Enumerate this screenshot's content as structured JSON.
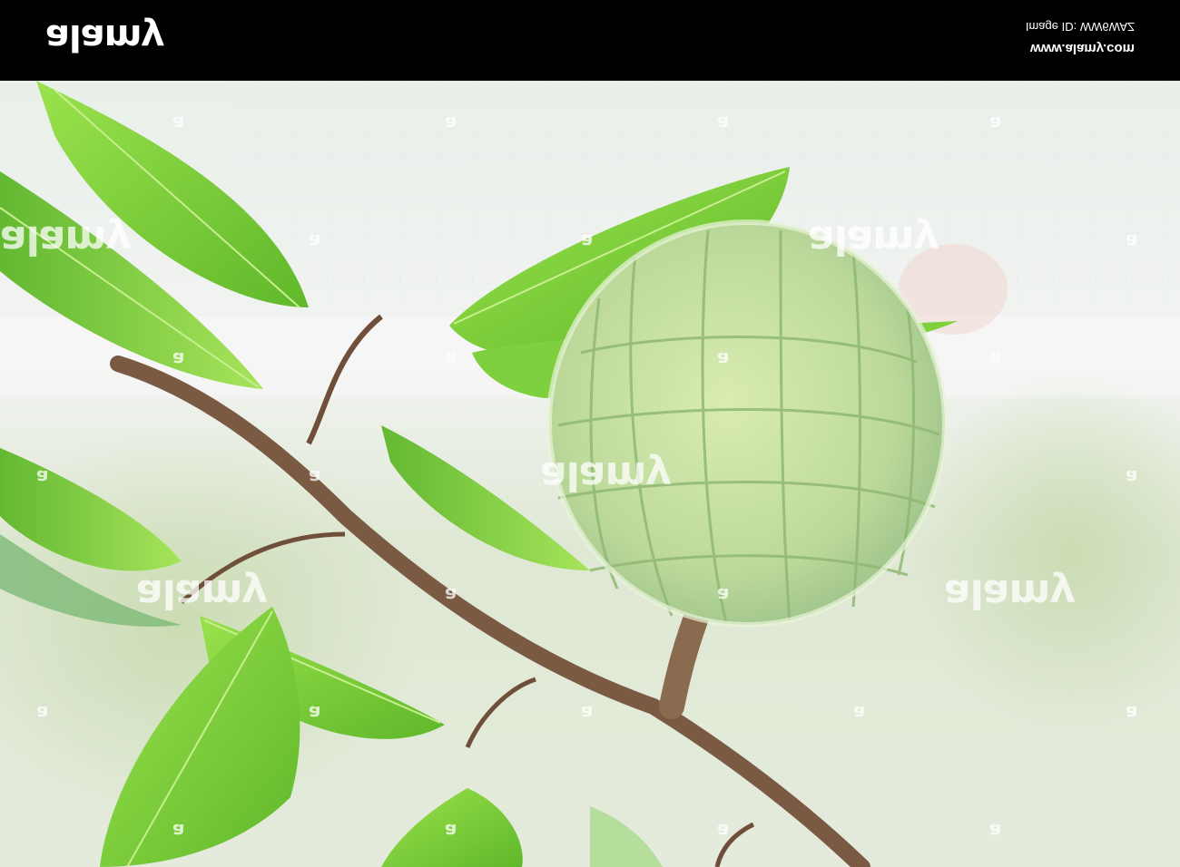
{
  "header": {
    "logo_text": "alamy",
    "site_url": "www.alamy.com",
    "image_id": "Image ID: WW6WAZ"
  },
  "photo": {
    "subject_icon": "custard-apple-photo",
    "watermark_text": "alamy",
    "watermark_letter": "a"
  },
  "colors": {
    "bar": "#000000",
    "leaf": "#7fd33a",
    "fruit": "#c7e3a2",
    "branch": "#7a5a43"
  }
}
